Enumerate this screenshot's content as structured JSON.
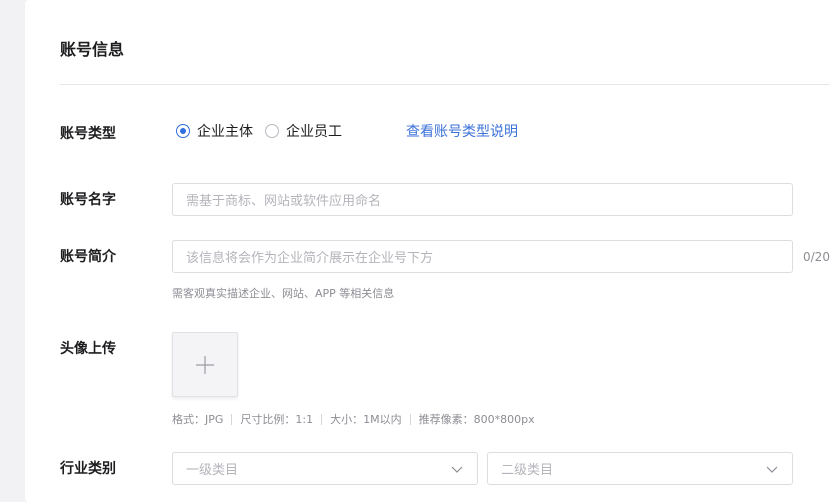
{
  "section": {
    "title": "账号信息"
  },
  "account_type": {
    "label": "账号类型",
    "options": [
      {
        "label": "企业主体",
        "checked": true
      },
      {
        "label": "企业员工",
        "checked": false
      }
    ],
    "help_link": "查看账号类型说明"
  },
  "account_name": {
    "label": "账号名字",
    "placeholder": "需基于商标、网站或软件应用命名"
  },
  "account_intro": {
    "label": "账号简介",
    "placeholder": "该信息将会作为企业简介展示在企业号下方",
    "counter": "0/20",
    "hint": "需客观真实描述企业、网站、APP 等相关信息"
  },
  "avatar": {
    "label": "头像上传",
    "specs": [
      "格式：JPG",
      "尺寸比例：1:1",
      "大小：1M以内",
      "推荐像素：800*800px"
    ]
  },
  "industry": {
    "label": "行业类别",
    "primary_placeholder": "一级类目",
    "secondary_placeholder": "二级类目"
  },
  "colors": {
    "accent": "#2f6fe0",
    "link": "#3c72d8"
  }
}
